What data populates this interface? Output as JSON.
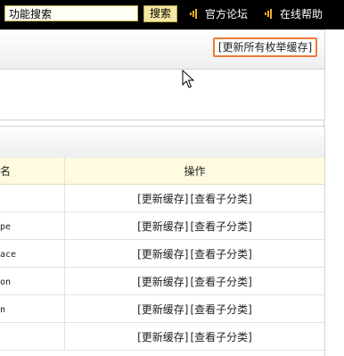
{
  "topbar": {
    "search_value": "功能搜索",
    "search_button": "搜索",
    "links": [
      "官方论坛",
      "在线帮助"
    ]
  },
  "panel1": {
    "refresh_all_label": "[更新所有枚举缓存]"
  },
  "table": {
    "headers": [
      "名",
      "操作"
    ],
    "rows": [
      {
        "name": "",
        "actions": [
          "[更新缓存]",
          "[查看子分类]"
        ]
      },
      {
        "name": "pe",
        "actions": [
          "[更新缓存]",
          "[查看子分类]"
        ]
      },
      {
        "name": "ace",
        "actions": [
          "[更新缓存]",
          "[查看子分类]"
        ]
      },
      {
        "name": "on",
        "actions": [
          "[更新缓存]",
          "[查看子分类]"
        ]
      },
      {
        "name": "n",
        "actions": [
          "[更新缓存]",
          "[查看子分类]"
        ]
      },
      {
        "name": "",
        "actions": [
          "[更新缓存]",
          "[查看子分类]"
        ]
      }
    ]
  },
  "colors": {
    "topbar_bg": "#000000",
    "search_button_bg": "#f5e7a3",
    "highlight_border": "#ee7a3a",
    "table_header_bg": "#fffbe0",
    "speaker_icon": "#f0b020"
  },
  "icons": [
    "speaker-icon",
    "mouse-cursor-icon"
  ]
}
